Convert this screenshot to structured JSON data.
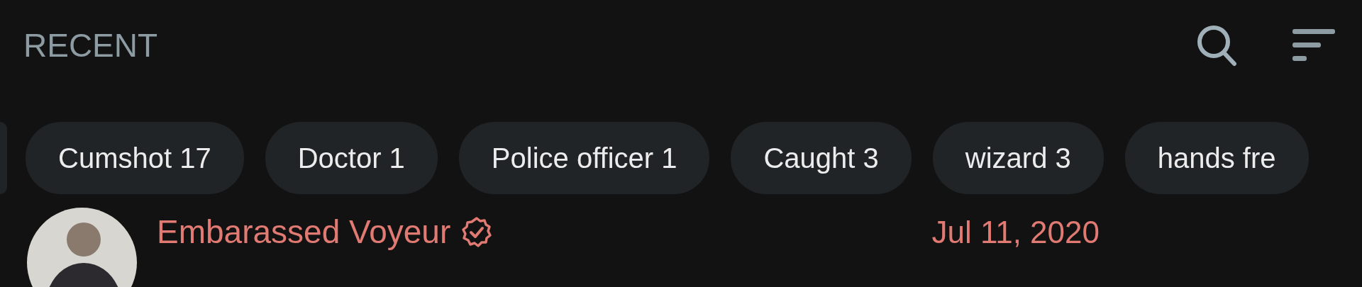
{
  "header": {
    "title": "RECENT"
  },
  "tags": [
    {
      "label": "Cumshot 17"
    },
    {
      "label": "Doctor 1"
    },
    {
      "label": "Police officer 1"
    },
    {
      "label": "Caught 3"
    },
    {
      "label": "wizard 3"
    },
    {
      "label": "hands fre"
    }
  ],
  "post": {
    "author": "Embarassed Voyeur",
    "verified": true,
    "date": "Jul 11, 2020"
  }
}
